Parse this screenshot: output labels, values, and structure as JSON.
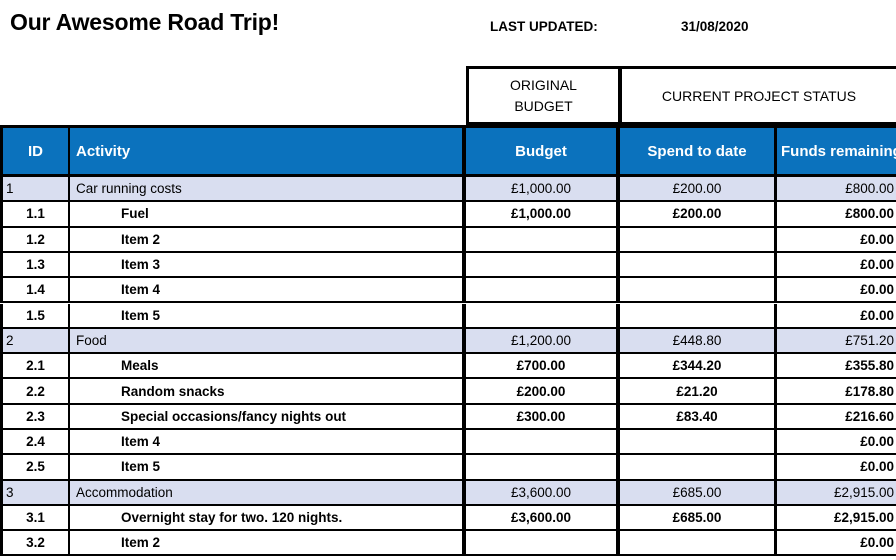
{
  "header": {
    "title": "Our Awesome Road Trip!",
    "last_updated_label": "LAST UPDATED:",
    "last_updated_value": "31/08/2020"
  },
  "table": {
    "group_headers": {
      "original_budget": "ORIGINAL BUDGET",
      "original_budget_line1": "ORIGINAL",
      "original_budget_line2": "BUDGET",
      "current_project_status": "CURRENT PROJECT STATUS"
    },
    "columns": {
      "id": "ID",
      "activity": "Activity",
      "budget": "Budget",
      "spend_to_date": "Spend to date",
      "funds_remaining": "Funds remaining"
    },
    "colors": {
      "header_blue": "#0B72BD",
      "category_fill": "#D9DEF0",
      "grid_black": "#000000",
      "row_white": "#FFFFFF"
    },
    "rows": [
      {
        "type": "category",
        "id": "1",
        "activity": "Car running costs",
        "budget": "£1,000.00",
        "spend": "£200.00",
        "funds": "£800.00"
      },
      {
        "type": "item",
        "id": "1.1",
        "activity": "Fuel",
        "budget": "£1,000.00",
        "spend": "£200.00",
        "funds": "£800.00"
      },
      {
        "type": "item",
        "id": "1.2",
        "activity": "Item 2",
        "budget": "",
        "spend": "",
        "funds": "£0.00"
      },
      {
        "type": "item",
        "id": "1.3",
        "activity": "Item 3",
        "budget": "",
        "spend": "",
        "funds": "£0.00"
      },
      {
        "type": "item",
        "id": "1.4",
        "activity": "Item 4",
        "budget": "",
        "spend": "",
        "funds": "£0.00"
      },
      {
        "type": "item",
        "id": "1.5",
        "activity": "Item 5",
        "budget": "",
        "spend": "",
        "funds": "£0.00"
      },
      {
        "type": "category",
        "id": "2",
        "activity": "Food",
        "budget": "£1,200.00",
        "spend": "£448.80",
        "funds": "£751.20"
      },
      {
        "type": "item",
        "id": "2.1",
        "activity": "Meals",
        "budget": "£700.00",
        "spend": "£344.20",
        "funds": "£355.80"
      },
      {
        "type": "item",
        "id": "2.2",
        "activity": "Random snacks",
        "budget": "£200.00",
        "spend": "£21.20",
        "funds": "£178.80"
      },
      {
        "type": "item",
        "id": "2.3",
        "activity": "Special occasions/fancy nights out",
        "budget": "£300.00",
        "spend": "£83.40",
        "funds": "£216.60"
      },
      {
        "type": "item",
        "id": "2.4",
        "activity": "Item 4",
        "budget": "",
        "spend": "",
        "funds": "£0.00"
      },
      {
        "type": "item",
        "id": "2.5",
        "activity": "Item 5",
        "budget": "",
        "spend": "",
        "funds": "£0.00"
      },
      {
        "type": "category",
        "id": "3",
        "activity": "Accommodation",
        "budget": "£3,600.00",
        "spend": "£685.00",
        "funds": "£2,915.00"
      },
      {
        "type": "item",
        "id": "3.1",
        "activity": "Overnight stay for two. 120 nights.",
        "budget": "£3,600.00",
        "spend": "£685.00",
        "funds": "£2,915.00"
      },
      {
        "type": "item",
        "id": "3.2",
        "activity": "Item 2",
        "budget": "",
        "spend": "",
        "funds": "£0.00"
      }
    ]
  }
}
